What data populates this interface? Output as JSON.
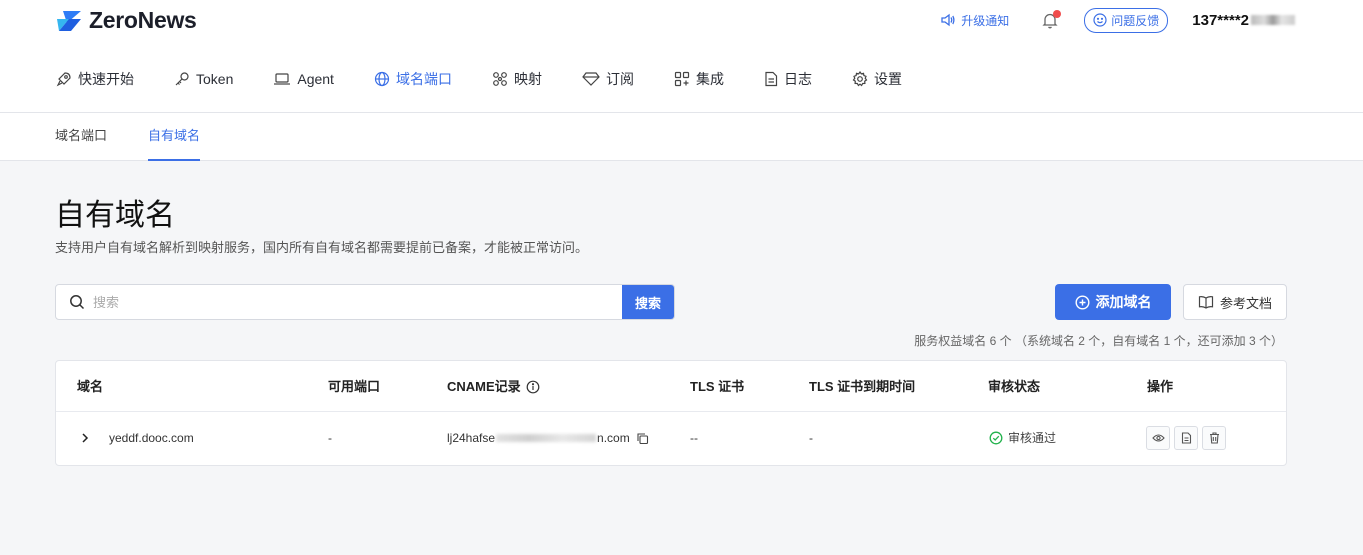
{
  "app": {
    "brand": "ZeroNews",
    "notice_label": "升级通知",
    "feedback_label": "问题反馈",
    "user_name": "137****2"
  },
  "nav": {
    "items": [
      {
        "label": "快速开始",
        "icon": "rocket-icon"
      },
      {
        "label": "Token",
        "icon": "key-icon"
      },
      {
        "label": "Agent",
        "icon": "laptop-icon"
      },
      {
        "label": "域名端口",
        "icon": "globe-icon"
      },
      {
        "label": "映射",
        "icon": "flower-icon"
      },
      {
        "label": "订阅",
        "icon": "diamond-icon"
      },
      {
        "label": "集成",
        "icon": "grid-plus-icon"
      },
      {
        "label": "日志",
        "icon": "file-icon"
      },
      {
        "label": "设置",
        "icon": "gear-icon"
      }
    ],
    "active_index": 3
  },
  "subnav": {
    "items": [
      "域名端口",
      "自有域名"
    ],
    "active_index": 1
  },
  "page": {
    "title": "自有域名",
    "description": "支持用户自有域名解析到映射服务，国内所有自有域名都需要提前已备案，才能被正常访问。"
  },
  "search": {
    "placeholder": "搜索",
    "value": "",
    "button_label": "搜索"
  },
  "actions": {
    "add_label": "添加域名",
    "doc_label": "参考文档"
  },
  "quota_text": "服务权益域名 6 个 （系统域名 2 个，自有域名 1 个，还可添加 3 个）",
  "table": {
    "columns": [
      "域名",
      "可用端口",
      "CNAME记录",
      "TLS 证书",
      "TLS 证书到期时间",
      "审核状态",
      "操作"
    ],
    "rows": [
      {
        "domain": "yeddf.dooc.com",
        "ports": "-",
        "cname_prefix": "lj24hafse",
        "cname_suffix": "n.com",
        "tls": "--",
        "tls_expire": "-",
        "status": "审核通过"
      }
    ]
  },
  "colors": {
    "accent": "#3b6fe6",
    "success": "#22b24c",
    "alert_dot": "#f04d4d"
  }
}
